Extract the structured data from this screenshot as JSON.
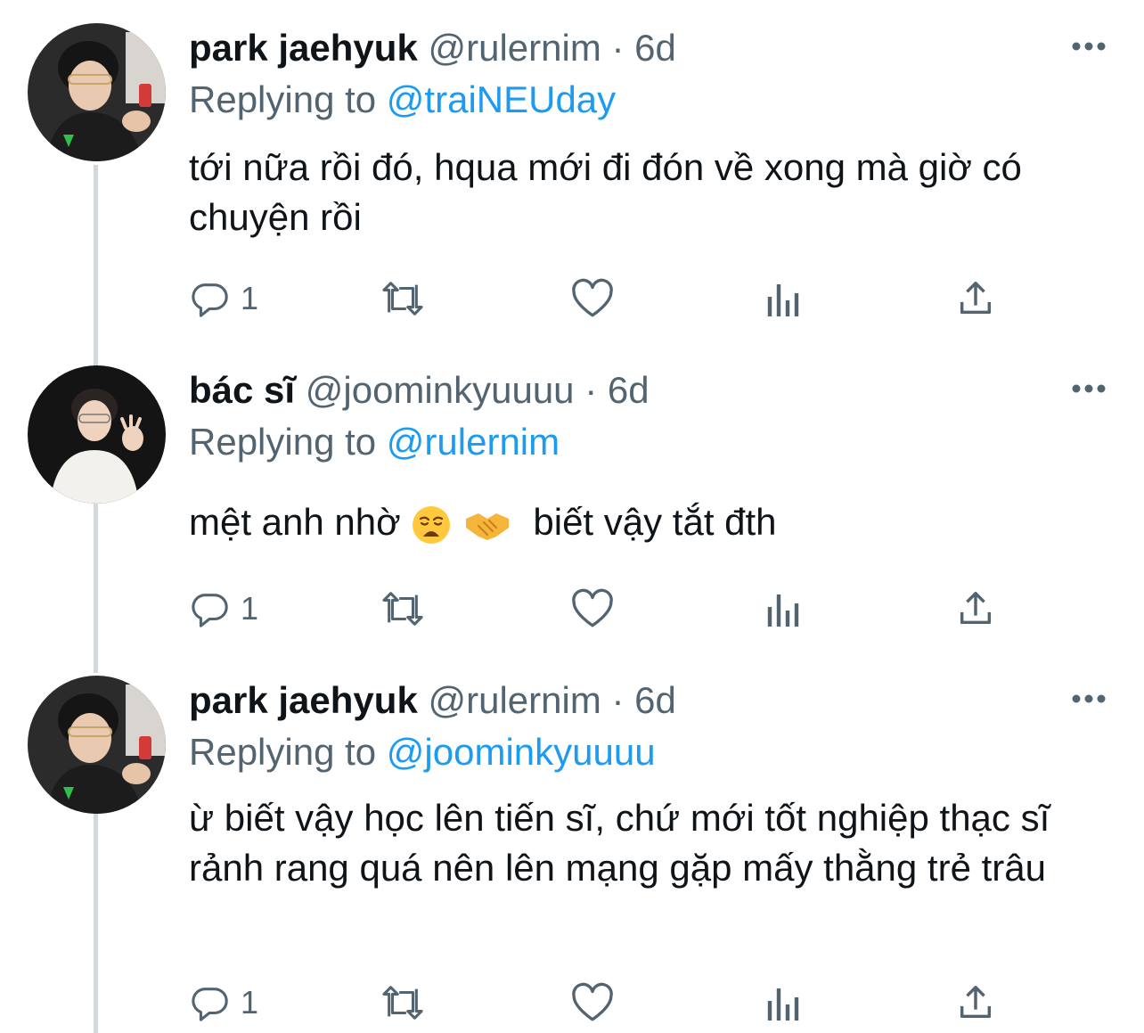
{
  "tweets": [
    {
      "name": "park jaehyuk",
      "handle": "@rulernim",
      "dot": "·",
      "time": "6d",
      "replying_label": "Replying to",
      "replying_to": "@traiNEUday",
      "body": "tới nữa rồi đó, hqua mới đi đón về xong mà giờ có chuyện rồi",
      "reply_count": "1"
    },
    {
      "name": "bác sĩ",
      "handle": "@joominkyuuuu",
      "dot": "·",
      "time": "6d",
      "replying_label": "Replying to",
      "replying_to": "@rulernim",
      "body_before": "mệt anh nhờ",
      "body_after": "biết vậy tắt đth",
      "emojis": [
        "weary-face",
        "handshake"
      ],
      "reply_count": "1"
    },
    {
      "name": "park jaehyuk",
      "handle": "@rulernim",
      "dot": "·",
      "time": "6d",
      "replying_label": "Replying to",
      "replying_to": "@joominkyuuuu",
      "body": "ừ biết vậy học lên tiến sĩ, chứ mới tốt nghiệp thạc sĩ rảnh rang quá nên lên mạng gặp mấy thằng trẻ trâu",
      "reply_count": "1"
    }
  ],
  "colors": {
    "text": "#0f1419",
    "secondary": "#536471",
    "link": "#1d9bf0",
    "thread_line": "#cfd9de"
  },
  "icons": [
    "reply-icon",
    "retweet-icon",
    "like-icon",
    "analytics-icon",
    "share-icon",
    "more-icon"
  ]
}
